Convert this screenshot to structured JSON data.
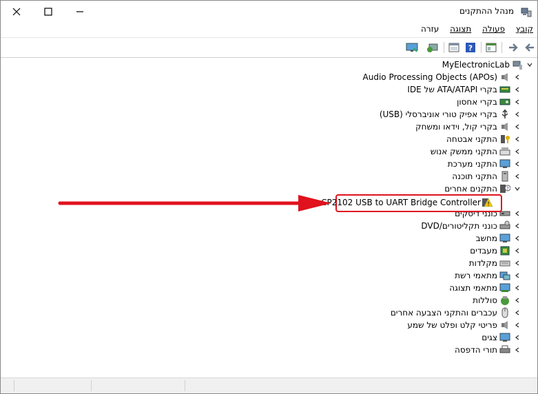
{
  "window": {
    "title": "מנהל ההתקנים",
    "controls": {
      "close": "✕",
      "maximize": "☐",
      "minimize": "—"
    }
  },
  "menu": {
    "items": [
      {
        "label": "קובץ"
      },
      {
        "label": "פעולה"
      },
      {
        "label": "תצוגה"
      },
      {
        "label": "עזרה"
      }
    ]
  },
  "toolbar": {
    "buttons": [
      "back-icon",
      "forward-icon",
      "properties-icon",
      "help-icon",
      "update-driver-icon",
      "scan-hardware-icon",
      "monitor-icon"
    ]
  },
  "tree": {
    "root": "MyElectronicLab",
    "categories": [
      {
        "label": "Audio Processing Objects (APOs)",
        "icon": "speaker-icon"
      },
      {
        "label": "בקרי ATA/ATAPI של IDE",
        "icon": "ide-controller-icon"
      },
      {
        "label": "בקרי אחסון",
        "icon": "storage-controller-icon"
      },
      {
        "label": "בקרי אפיק טורי אוניברסלי (USB)",
        "icon": "usb-icon"
      },
      {
        "label": "בקרי קול, וידאו ומשחק",
        "icon": "sound-icon"
      },
      {
        "label": "התקני אבטחה",
        "icon": "security-device-icon"
      },
      {
        "label": "התקני ממשק אנוש",
        "icon": "hid-icon"
      },
      {
        "label": "התקני מערכת",
        "icon": "system-device-icon"
      },
      {
        "label": "התקני תוכנה",
        "icon": "software-device-icon"
      },
      {
        "label": "התקנים אחרים",
        "icon": "other-devices-icon",
        "expanded": true
      },
      {
        "label": "כונני דיסקים",
        "icon": "disk-drive-icon"
      },
      {
        "label": "כונני תקליטורים/DVD",
        "icon": "dvd-drive-icon"
      },
      {
        "label": "מחשב",
        "icon": "computer-icon"
      },
      {
        "label": "מעבדים",
        "icon": "processor-icon"
      },
      {
        "label": "מקלדות",
        "icon": "keyboard-icon"
      },
      {
        "label": "מתאמי רשת",
        "icon": "network-adapter-icon"
      },
      {
        "label": "מתאמי תצוגה",
        "icon": "display-adapter-icon"
      },
      {
        "label": "סוללות",
        "icon": "battery-icon"
      },
      {
        "label": "עכברים והתקני הצבעה אחרים",
        "icon": "mouse-icon"
      },
      {
        "label": "פריטי קלט ופלט של שמע",
        "icon": "audio-io-icon"
      },
      {
        "label": "צגים",
        "icon": "monitor-icon"
      },
      {
        "label": "תורי הדפסה",
        "icon": "printer-icon"
      }
    ],
    "child_device": {
      "label": "CP2102 USB to UART Bridge Controller",
      "icon": "warning-device-icon"
    }
  },
  "colors": {
    "annotation_red": "#e0121e",
    "accent_blue": "#1e6fd9"
  }
}
